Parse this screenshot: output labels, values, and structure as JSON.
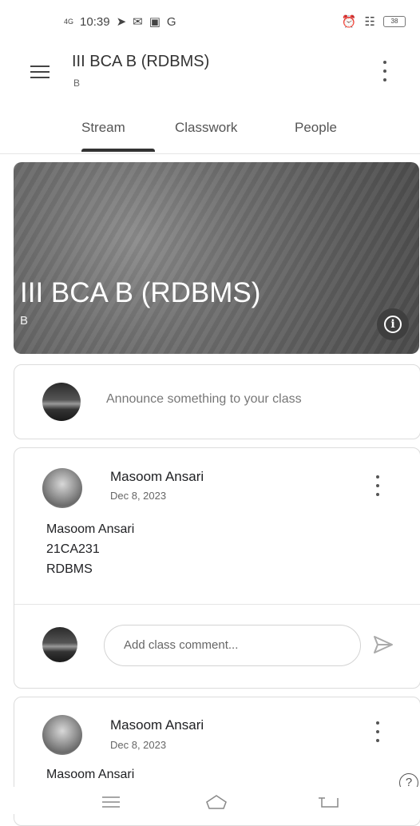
{
  "status_bar": {
    "network": "4G",
    "time": "10:39",
    "app_letter": "G",
    "battery": "38"
  },
  "app_bar": {
    "title": "III BCA B (RDBMS)",
    "subtitle": "B"
  },
  "tabs": [
    {
      "label": "Stream",
      "active": true
    },
    {
      "label": "Classwork",
      "active": false
    },
    {
      "label": "People",
      "active": false
    }
  ],
  "banner": {
    "title": "III BCA B (RDBMS)",
    "section": "B"
  },
  "announce": {
    "placeholder": "Announce something to your class"
  },
  "posts": [
    {
      "author": "Masoom Ansari",
      "date": "Dec 8, 2023",
      "body_lines": [
        "Masoom Ansari",
        "21CA231",
        "RDBMS"
      ],
      "comment_placeholder": "Add class comment..."
    },
    {
      "author": "Masoom Ansari",
      "date": "Dec 8, 2023",
      "body_lines": [
        "Masoom Ansari"
      ]
    }
  ],
  "help": {
    "glyph": "?"
  },
  "icons": {
    "menu": "hamburger-menu-icon",
    "more": "more-vert-icon",
    "info": "info-icon",
    "send": "send-icon",
    "help": "help-icon"
  },
  "colors": {
    "banner": "#666666",
    "text": "#202124",
    "secondary_text": "#666666"
  }
}
